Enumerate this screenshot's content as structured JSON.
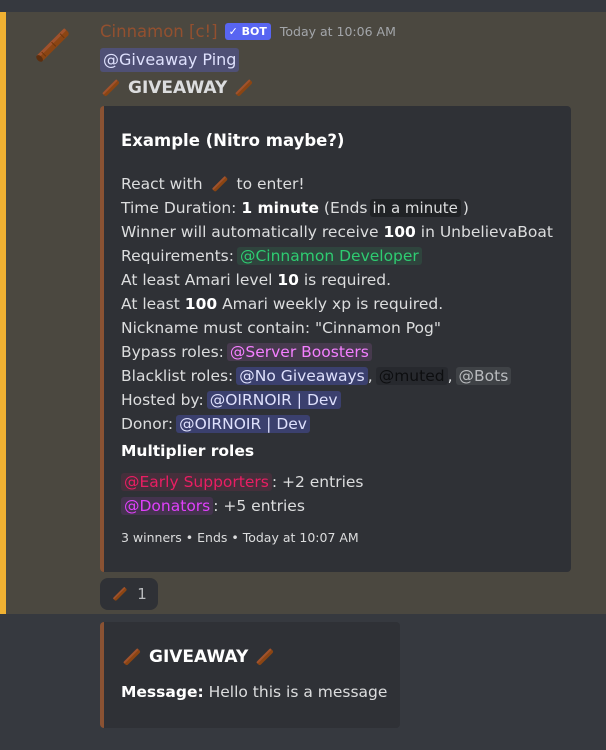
{
  "message": {
    "author": "Cinnamon [c!]",
    "bot_tag": "✓ BOT",
    "timestamp": "Today at 10:06 AM",
    "ping": "@Giveaway Ping",
    "heading": "GIVEAWAY",
    "emoji": "cinnamon-stick-icon",
    "colors": {
      "highlight_bar": "#f0b132",
      "embed_border": "#8a5233",
      "author": "#a0522d",
      "bot_tag": "#5865f2"
    }
  },
  "embed": {
    "title": "Example (Nitro maybe?)",
    "react_pre": "React with",
    "react_post": "to enter!",
    "duration_label": "Time Duration:",
    "duration_value": "1 minute",
    "duration_ends_pre": "(Ends",
    "duration_ends_code": "in a minute",
    "duration_ends_post": ")",
    "winner_pre": "Winner will automatically receive",
    "winner_amount": "100",
    "winner_post": "in UnbelievaBoat",
    "requirements_label": "Requirements:",
    "requirements_role": "@Cinnamon Developer",
    "amari_level_pre": "At least Amari level",
    "amari_level_value": "10",
    "amari_level_post": "is required.",
    "amari_xp_pre": "At least",
    "amari_xp_value": "100",
    "amari_xp_post": "Amari weekly xp is required.",
    "nickname": "Nickname must contain: \"Cinnamon Pog\"",
    "bypass_label": "Bypass roles:",
    "bypass_role": "@Server Boosters",
    "blacklist_label": "Blacklist roles:",
    "blacklist_roles": [
      "@No Giveaways",
      "@muted",
      "@Bots"
    ],
    "hosted_label": "Hosted by:",
    "hosted_user": "@OIRNOIR | Dev",
    "donor_label": "Donor:",
    "donor_user": "@OIRNOIR | Dev",
    "multiplier_heading": "Multiplier roles",
    "multipliers": [
      {
        "role": "@Early Supporters",
        "entries": ": +2 entries"
      },
      {
        "role": "@Donators",
        "entries": ": +5 entries"
      }
    ],
    "footer": "3 winners • Ends • Today at 10:07 AM"
  },
  "reaction": {
    "count": "1"
  },
  "embed2": {
    "title": "GIVEAWAY",
    "message_label": "Message:",
    "message_text": "Hello this is a message"
  }
}
